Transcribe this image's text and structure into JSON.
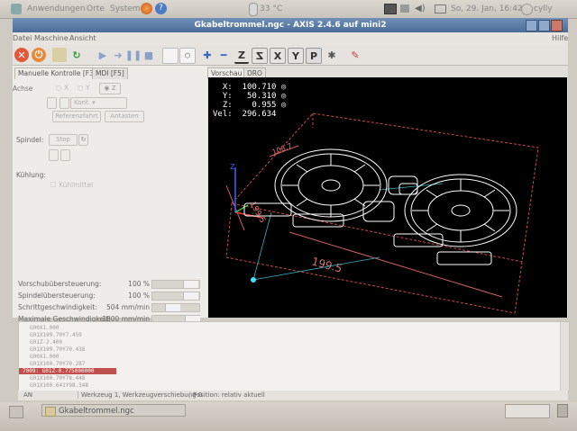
{
  "panel": {
    "apps": "Anwendungen",
    "places": "Orte",
    "system": "System",
    "temperature": "33 °C",
    "datetime": "So, 29. Jan, 16:42",
    "user": "cylly"
  },
  "window": {
    "title": "Gkabeltrommel.ngc - AXIS 2.4.6 auf mini2"
  },
  "menu": {
    "file": "Datei",
    "machine": "Maschine",
    "view": "Ansicht",
    "help": "Hilfe"
  },
  "toolbar": {
    "view_z": "Z",
    "view_z_rot": "Z",
    "view_x": "X",
    "view_y": "Y",
    "view_p": "P"
  },
  "tabs": {
    "manual": "Manuelle Kontrolle [F3]",
    "mdi": "MDI [F5]",
    "preview": "Vorschau",
    "dro": "DRO"
  },
  "manual": {
    "axis_label": "Achse",
    "axis_x": "X",
    "axis_y": "Y",
    "axis_z": "Z",
    "jog_increment": "Kont.",
    "home_button": "Referenzfahrt",
    "touch_off_button": "Antasten",
    "spindle_label": "Spindel:",
    "spindle_stop": "Stop",
    "cooling_label": "Kühlung:",
    "coolant_check": "Kühlmittel"
  },
  "overrides": [
    {
      "label": "Vorschubübersteuerung:",
      "value": "100 %",
      "fraction": 1.0
    },
    {
      "label": "Spindelübersteuerung:",
      "value": "100 %",
      "fraction": 1.0
    },
    {
      "label": "Schrittgeschwindigkeit:",
      "value": "504 mm/min",
      "fraction": 0.4
    },
    {
      "label": "Maximale Geschwindigkeit:",
      "value": "1800 mm/min",
      "fraction": 1.0
    }
  ],
  "dro": {
    "x_label": "X:",
    "x_value": "100.710",
    "y_label": "Y:",
    "y_value": "50.310",
    "z_label": "Z:",
    "z_value": "0.955",
    "vel_label": "Vel:",
    "vel_value": "296.634"
  },
  "dimensions": {
    "width_label": "199.5",
    "depth_label": "199.5",
    "height_label": "108.7"
  },
  "gcode_lines": [
    "G00X1.000",
    "G01X199.70Y7.459",
    "G01Z-2.400",
    "G01X199.70Y70.438",
    "G00X1.000",
    "G01X100.70Y70.287",
    "7009: G01Z-0.775000000",
    "G01X100.70Y78.448",
    "G01X100.641Y98.348"
  ],
  "gcode_active_index": 6,
  "status": {
    "state": "AN",
    "tool": "Werkzeug 1, Werkzeugverschiebung 0",
    "position": "Position: relativ aktuell"
  },
  "taskbar": {
    "task": "Gkabeltrommel.ngc"
  },
  "colors": {
    "titlebar": "#4a6d98",
    "canvas": "#000000",
    "toolpath": "#ffffff",
    "bounds": "#c84a4a",
    "active_line": "#c0504d"
  }
}
